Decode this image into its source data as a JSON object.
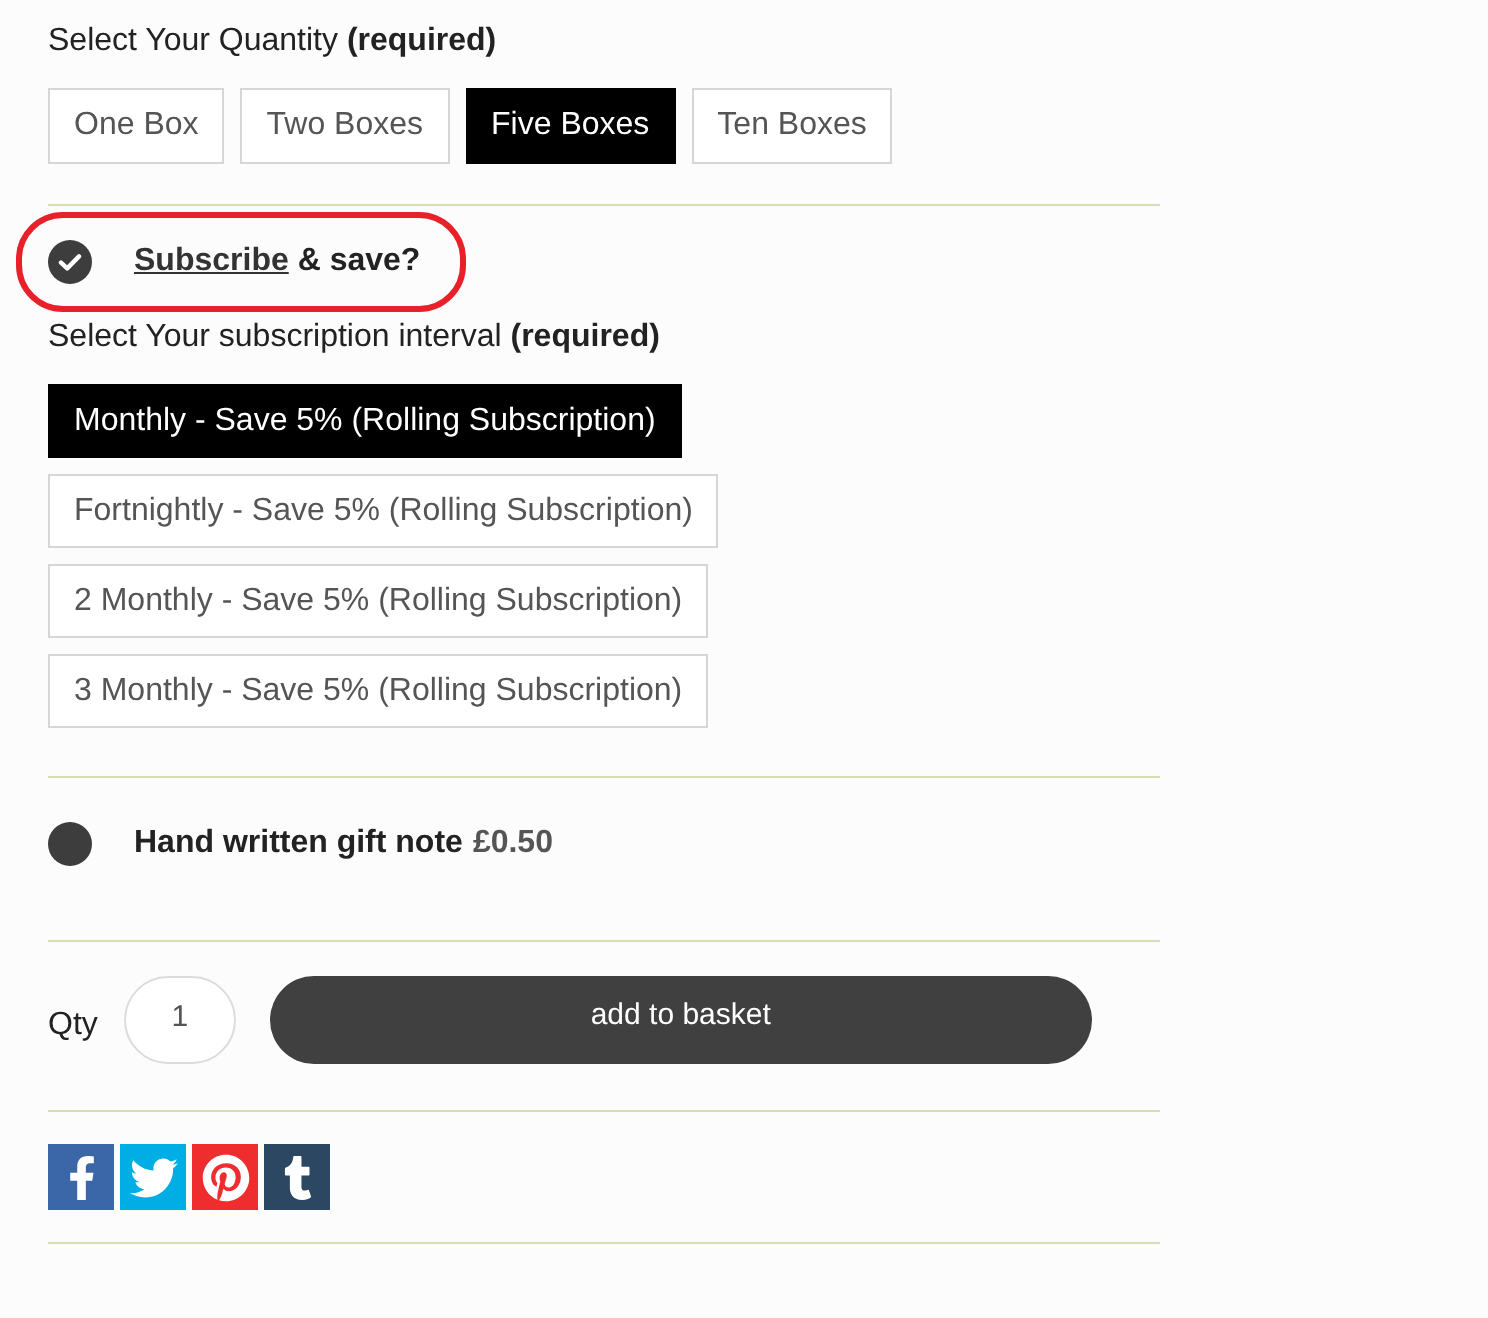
{
  "quantity": {
    "label": "Select Your Quantity **(required)**",
    "options": [
      {
        "label": "One Box",
        "selected": false
      },
      {
        "label": "Two Boxes",
        "selected": false
      },
      {
        "label": "Five Boxes",
        "selected": true
      },
      {
        "label": "Ten Boxes",
        "selected": false
      }
    ]
  },
  "subscribe": {
    "checked": true,
    "highlighted": true,
    "link": "Subscribe",
    "text": "& save?"
  },
  "interval": {
    "label": "Select Your subscription interval **(required)**",
    "options": [
      {
        "label": "Monthly - Save 5% (Rolling Subscription)",
        "selected": true
      },
      {
        "label": "Fortnightly - Save 5% (Rolling Subscription)",
        "selected": false
      },
      {
        "label": "2 Monthly - Save 5% (Rolling Subscription)",
        "selected": false
      },
      {
        "label": "3 Monthly - Save 5% (Rolling Subscription)",
        "selected": false
      }
    ]
  },
  "gift_note": {
    "checked": false,
    "label": "Hand written gift note",
    "price": "£0.50"
  },
  "purchase": {
    "qty_label": "Qty",
    "qty_value": "1",
    "button": "add to basket"
  },
  "share_buttons": [
    {
      "kind": "facebook"
    },
    {
      "kind": "twitter"
    },
    {
      "kind": "pinterest"
    },
    {
      "kind": "tumblr"
    }
  ]
}
